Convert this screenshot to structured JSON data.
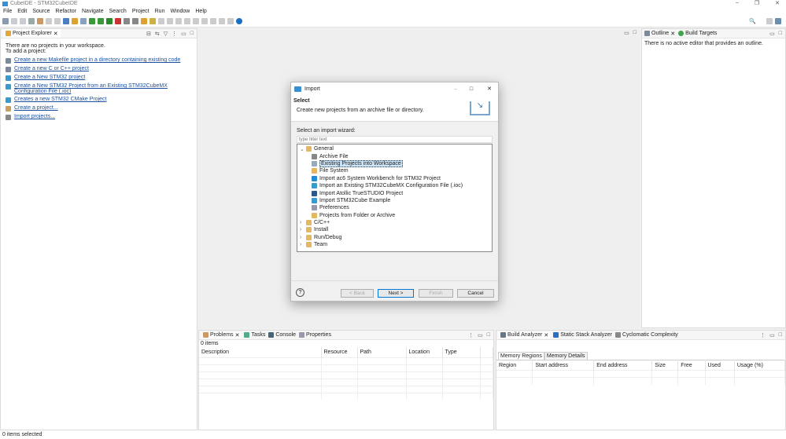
{
  "window": {
    "title": "CubeIDE - STM32CubeIDE",
    "min": "–",
    "max": "❐",
    "close": "✕"
  },
  "menu": [
    "File",
    "Edit",
    "Source",
    "Refactor",
    "Navigate",
    "Search",
    "Project",
    "Run",
    "Window",
    "Help"
  ],
  "project_explorer": {
    "tab": "Project Explorer",
    "intro1": "There are no projects in your workspace.",
    "intro2": "To add a project:",
    "links": [
      "Create a new Makefile project in a directory containing existing code",
      "Create a new C or C++ project",
      "Create a New STM32 project",
      "Create a New STM32 Project from an Existing STM32CubeMX Configuration File (.ioc)",
      "Creates a new STM32 CMake Project",
      "Create a project...",
      "Import projects..."
    ]
  },
  "outline": {
    "tab1": "Outline",
    "tab2": "Build Targets",
    "message": "There is no active editor that provides an outline."
  },
  "dialog": {
    "title": "Import",
    "heading": "Select",
    "description": "Create new projects from an archive file or directory.",
    "wizard_label": "Select an import wizard:",
    "filter_placeholder": "type filter text",
    "tree": [
      {
        "label": "General",
        "level": 0,
        "expanded": true,
        "folder": true
      },
      {
        "label": "Archive File",
        "level": 1
      },
      {
        "label": "Existing Projects into Workspace",
        "level": 1,
        "selected": true
      },
      {
        "label": "File System",
        "level": 1
      },
      {
        "label": "Import ac6 System Workbench for STM32 Project",
        "level": 1
      },
      {
        "label": "Import an Existing STM32CubeMX Configuration File (.ioc)",
        "level": 1
      },
      {
        "label": "Import Atollic TrueSTUDIO Project",
        "level": 1
      },
      {
        "label": "Import STM32Cube Example",
        "level": 1
      },
      {
        "label": "Preferences",
        "level": 1
      },
      {
        "label": "Projects from Folder or Archive",
        "level": 1
      },
      {
        "label": "C/C++",
        "level": 0,
        "folder": true
      },
      {
        "label": "Install",
        "level": 0,
        "folder": true
      },
      {
        "label": "Run/Debug",
        "level": 0,
        "folder": true
      },
      {
        "label": "Team",
        "level": 0,
        "folder": true
      }
    ],
    "help": "?",
    "back": "< Back",
    "next": "Next >",
    "finish": "Finish",
    "cancel": "Cancel"
  },
  "problems": {
    "tabs": [
      "Problems",
      "Tasks",
      "Console",
      "Properties"
    ],
    "count": "0 items",
    "columns": [
      "Description",
      "Resource",
      "Path",
      "Location",
      "Type"
    ]
  },
  "build_analyzer": {
    "tabs": [
      "Build Analyzer",
      "Static Stack Analyzer",
      "Cyclomatic Complexity"
    ],
    "subtabs": [
      "Memory Regions",
      "Memory Details"
    ],
    "columns": [
      "Region",
      "Start address",
      "End address",
      "Size",
      "Free",
      "Used",
      "Usage (%)"
    ]
  },
  "status": "0 items selected"
}
